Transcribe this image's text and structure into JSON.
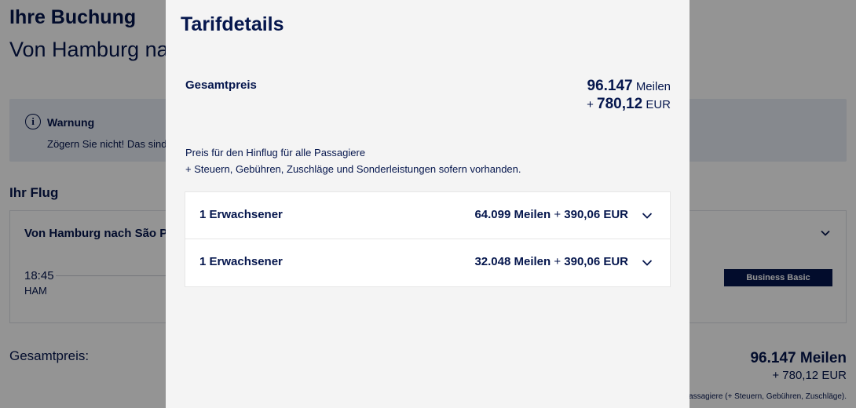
{
  "background": {
    "title": "Ihre Buchung",
    "subtitle": "Von Hamburg na",
    "warning": {
      "title": "Warnung",
      "icon_glyph": "i",
      "text": "Zögern Sie nicht! Das sind"
    },
    "flight_heading": "Ihr Flug",
    "flight": {
      "route": "Von Hamburg nach São Pa",
      "time": "18:45",
      "airport": "HAM",
      "fare_badge": "Business Basic"
    },
    "total": {
      "label": "Gesamtpreis:",
      "miles": "96.147 Meilen",
      "eur": "+ 780,12 EUR",
      "note": "assagiere (+ Steuern, Gebühren, Zuschläge)."
    }
  },
  "modal": {
    "title": "Tarifdetails",
    "total_label": "Gesamtpreis",
    "total_miles_value": "96.147",
    "total_miles_unit": "Meilen",
    "total_plus": "+",
    "total_eur_value": "780,12",
    "total_eur_unit": "EUR",
    "description_line1": "Preis für den Hinflug für alle Passagiere",
    "description_line2": "+ Steuern, Gebühren, Zuschläge und Sonderleistungen sofern vorhanden.",
    "passengers": [
      {
        "label": "1 Erwachsener",
        "miles": "64.099 Meilen",
        "plus": "+",
        "eur": "390,06 EUR"
      },
      {
        "label": "1 Erwachsener",
        "miles": "32.048 Meilen",
        "plus": "+",
        "eur": "390,06 EUR"
      }
    ]
  },
  "colors": {
    "brand_navy": "#05164d",
    "modal_bg": "#f4f4f4",
    "overlay": "rgba(0,0,0,0.42)"
  },
  "icons": {
    "chevron": "chevron-down-icon",
    "warning": "info-icon"
  }
}
